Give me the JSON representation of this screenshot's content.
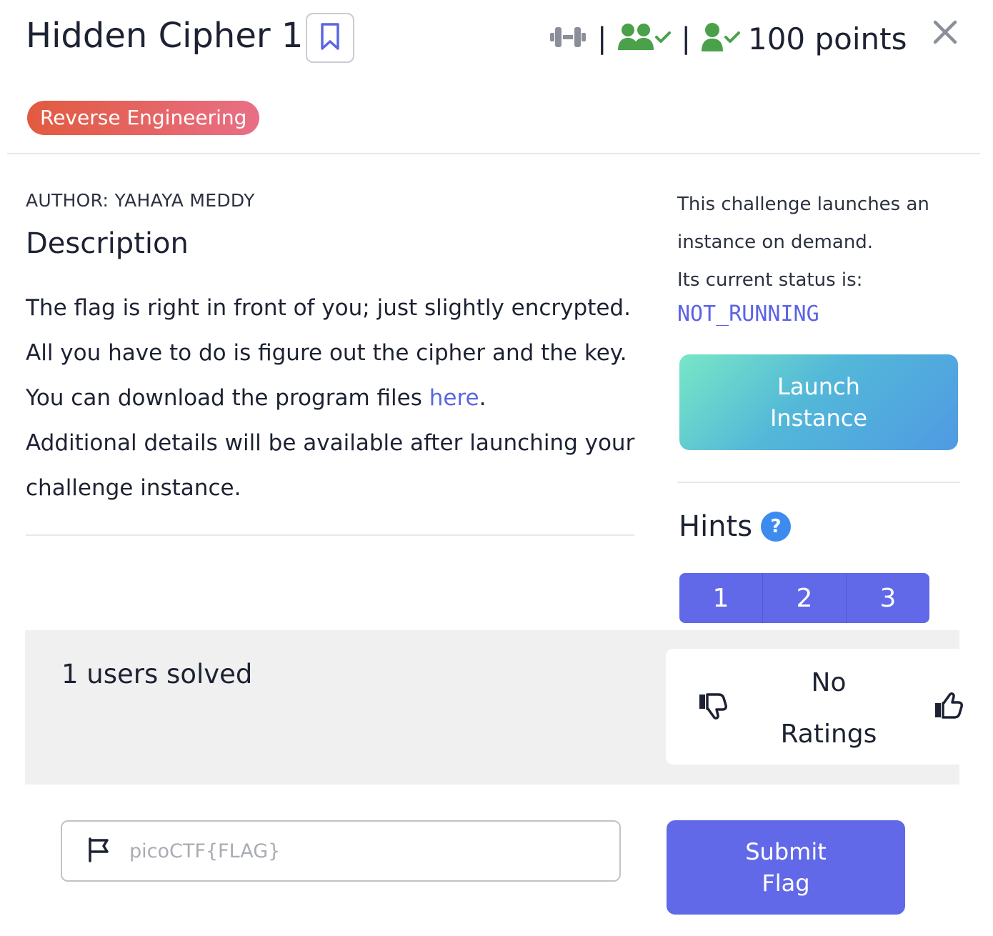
{
  "challenge": {
    "title": "Hidden Cipher 1",
    "points": "100 points",
    "category": "Reverse Engineering",
    "author": "AUTHOR: YAHAYA MEDDY"
  },
  "header": {
    "separator": "|",
    "icons": [
      "difficulty-dumbbell-icon",
      "users-check-icon",
      "user-check-icon",
      "bookmark-icon",
      "close-icon"
    ]
  },
  "description": {
    "heading": "Description",
    "line1": "The flag is right in front of you; just slightly encrypted.",
    "line2": "All you have to do is figure out the cipher and the key.",
    "line3_prefix": "You can download the program files ",
    "line3_link": "here",
    "line3_suffix": ".",
    "line4": "Additional details will be available after launching your challenge instance."
  },
  "instance": {
    "info_line1": "This challenge launches an instance on demand.",
    "info_line2": "Its current status is:",
    "status": "NOT_RUNNING",
    "launch_label_1": "Launch",
    "launch_label_2": "Instance"
  },
  "hints": {
    "heading": "Hints",
    "help_glyph": "?",
    "buttons": [
      "1",
      "2",
      "3"
    ]
  },
  "stats": {
    "solved": "1 users solved",
    "rating_1": "No",
    "rating_2": "Ratings"
  },
  "flag": {
    "placeholder": "picoCTF{FLAG}",
    "submit_label_1": "Submit",
    "submit_label_2": "Flag"
  },
  "colors": {
    "accent": "#6169e8",
    "link": "#5a67e0",
    "green_icon": "#4aa14a",
    "badge_start": "#e25a3f",
    "badge_end": "#e86f86",
    "help": "#3d8bef"
  }
}
